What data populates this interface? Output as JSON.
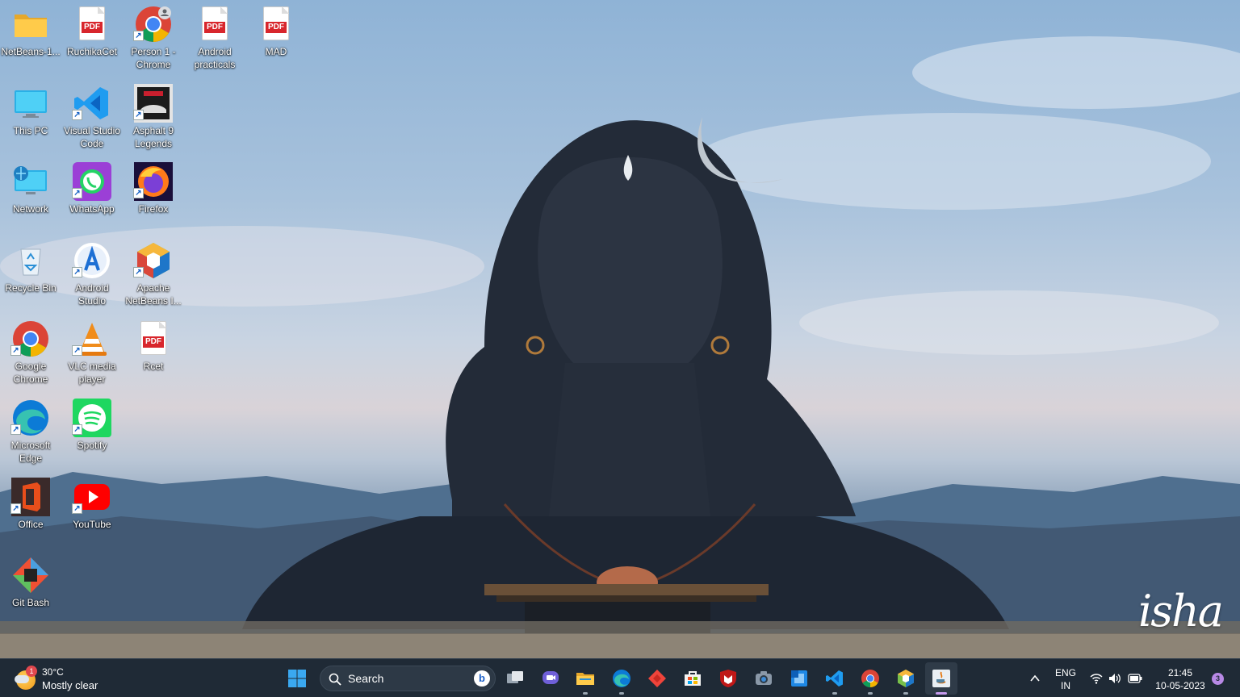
{
  "wallpaper": {
    "watermark": "isha"
  },
  "desktop_icons": [
    {
      "label": "NetBeans-1...",
      "icon": "folder-icon"
    },
    {
      "label": "RuchikaCet",
      "icon": "pdf-icon",
      "pdf_badge": "PDF"
    },
    {
      "label": "Person 1 - Chrome",
      "icon": "chrome-profile-icon"
    },
    {
      "label": "Android practicals",
      "icon": "pdf-icon",
      "pdf_badge": "PDF"
    },
    {
      "label": "MAD",
      "icon": "pdf-icon",
      "pdf_badge": "PDF"
    },
    {
      "label": "This PC",
      "icon": "monitor-icon"
    },
    {
      "label": "Visual Studio Code",
      "icon": "vscode-icon"
    },
    {
      "label": "Asphalt 9 Legends",
      "icon": "asphalt-icon"
    },
    {
      "label": "Network",
      "icon": "network-icon"
    },
    {
      "label": "WhatsApp",
      "icon": "whatsapp-icon"
    },
    {
      "label": "Firefox",
      "icon": "firefox-icon"
    },
    {
      "label": "Recycle Bin",
      "icon": "recycle-bin-icon"
    },
    {
      "label": "Android Studio",
      "icon": "android-studio-icon"
    },
    {
      "label": "Apache NetBeans I...",
      "icon": "netbeans-icon"
    },
    {
      "label": "Google Chrome",
      "icon": "chrome-icon"
    },
    {
      "label": "VLC media player",
      "icon": "vlc-icon"
    },
    {
      "label": "Rcet",
      "icon": "pdf-icon",
      "pdf_badge": "PDF"
    },
    {
      "label": "Microsoft Edge",
      "icon": "edge-icon"
    },
    {
      "label": "Spotify",
      "icon": "spotify-icon"
    },
    {
      "label": "Office",
      "icon": "office-icon"
    },
    {
      "label": "YouTube",
      "icon": "youtube-icon"
    },
    {
      "label": "Git Bash",
      "icon": "git-bash-icon"
    }
  ],
  "taskbar": {
    "weather": {
      "temp": "30°C",
      "condition": "Mostly clear",
      "badge": "1"
    },
    "search_label": "Search",
    "bing_glyph": "b",
    "apps": [
      {
        "name": "start",
        "icon": "windows-start-icon"
      },
      {
        "name": "task-view",
        "icon": "task-view-icon"
      },
      {
        "name": "teams-chat",
        "icon": "teams-icon"
      },
      {
        "name": "file-explorer",
        "icon": "folder-icon"
      },
      {
        "name": "edge",
        "icon": "edge-icon"
      },
      {
        "name": "anydesk",
        "icon": "diamond-app-icon"
      },
      {
        "name": "microsoft-store",
        "icon": "store-icon"
      },
      {
        "name": "mcafee",
        "icon": "mcafee-icon"
      },
      {
        "name": "camera",
        "icon": "camera-icon"
      },
      {
        "name": "widgets-app",
        "icon": "blue-app-icon"
      },
      {
        "name": "vscode",
        "icon": "vscode-icon"
      },
      {
        "name": "chrome",
        "icon": "chrome-icon"
      },
      {
        "name": "netbeans",
        "icon": "netbeans-icon"
      },
      {
        "name": "java",
        "icon": "java-icon"
      }
    ],
    "tray": {
      "lang_line1": "ENG",
      "lang_line2": "IN",
      "time": "21:45",
      "date": "10-05-2023",
      "notifications": "3"
    }
  }
}
